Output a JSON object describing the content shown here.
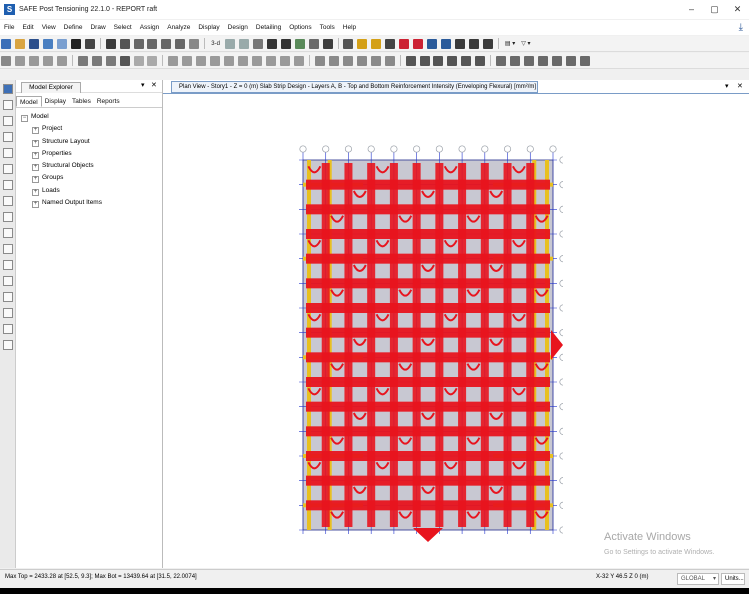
{
  "window": {
    "title": "SAFE Post Tensioning 22.1.0 - REPORT raft",
    "app_icon_letter": "S",
    "minimize": "–",
    "maximize": "▢",
    "close": "✕"
  },
  "menu": [
    "File",
    "Edit",
    "View",
    "Define",
    "Draw",
    "Select",
    "Assign",
    "Analyze",
    "Display",
    "Design",
    "Detailing",
    "Options",
    "Tools",
    "Help"
  ],
  "toolbar": {
    "zoom_label": "3-d",
    "snap_label": "▤ ▾",
    "filter_label": "▽ ▾"
  },
  "model_explorer": {
    "title": "Model Explorer",
    "pin": "▾",
    "close": "✕",
    "tabs": [
      "Model",
      "Display",
      "Tables",
      "Reports"
    ],
    "tree_root": "Model",
    "tree_items": [
      "Project",
      "Structure Layout",
      "Properties",
      "Structural Objects",
      "Groups",
      "Loads",
      "Named Output Items"
    ]
  },
  "canvas": {
    "tab_title": "Plan View - Story1 - Z = 0 (m)  Slab Strip Design - Layers A, B - Top and Bottom Reinforcement Intensity (Enveloping Flexural) [mm²/m]",
    "tab_close": "✕",
    "dropdown": "▾"
  },
  "watermark": {
    "line1": "Activate Windows",
    "line2": "Go to Settings to activate Windows."
  },
  "status": {
    "max_text": "Max Top = 2433.28 at [52.5, 9.3];  Max Bot = 13439.64 at [31.5, 22.0074]",
    "coords": "X-32  Y 46.5  Z 0 (m)",
    "coord_system": "GLOBAL",
    "units": "Units..."
  },
  "colors": {
    "slab": "#c8c8d2",
    "grid_blue": "#2233cc",
    "reinforcement_red": "#e8141e",
    "strip_yellow": "#e8c020",
    "bubble": "#9aa0a8"
  }
}
